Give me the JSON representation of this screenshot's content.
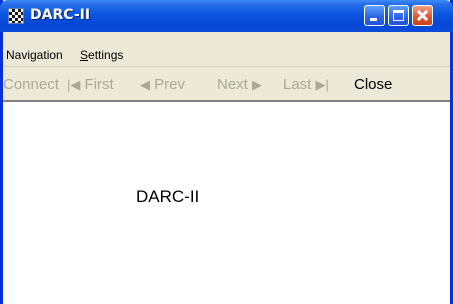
{
  "window": {
    "title": "DARC-II",
    "controls": {
      "minimize": "minimize",
      "maximize": "maximize",
      "close": "close"
    }
  },
  "menu": {
    "navigation": "Navigation",
    "settings_prefix": "",
    "settings_underlined": "S",
    "settings_rest": "ettings"
  },
  "toolbar": {
    "connect": "Connect",
    "first": "First",
    "prev": "Prev",
    "next": "Next",
    "last": "Last",
    "close": "Close"
  },
  "content": {
    "text": "DARC-II"
  },
  "colors": {
    "title_bar": "#0a56e0",
    "frame": "#0831d9",
    "disabled_text": "#aca899"
  }
}
